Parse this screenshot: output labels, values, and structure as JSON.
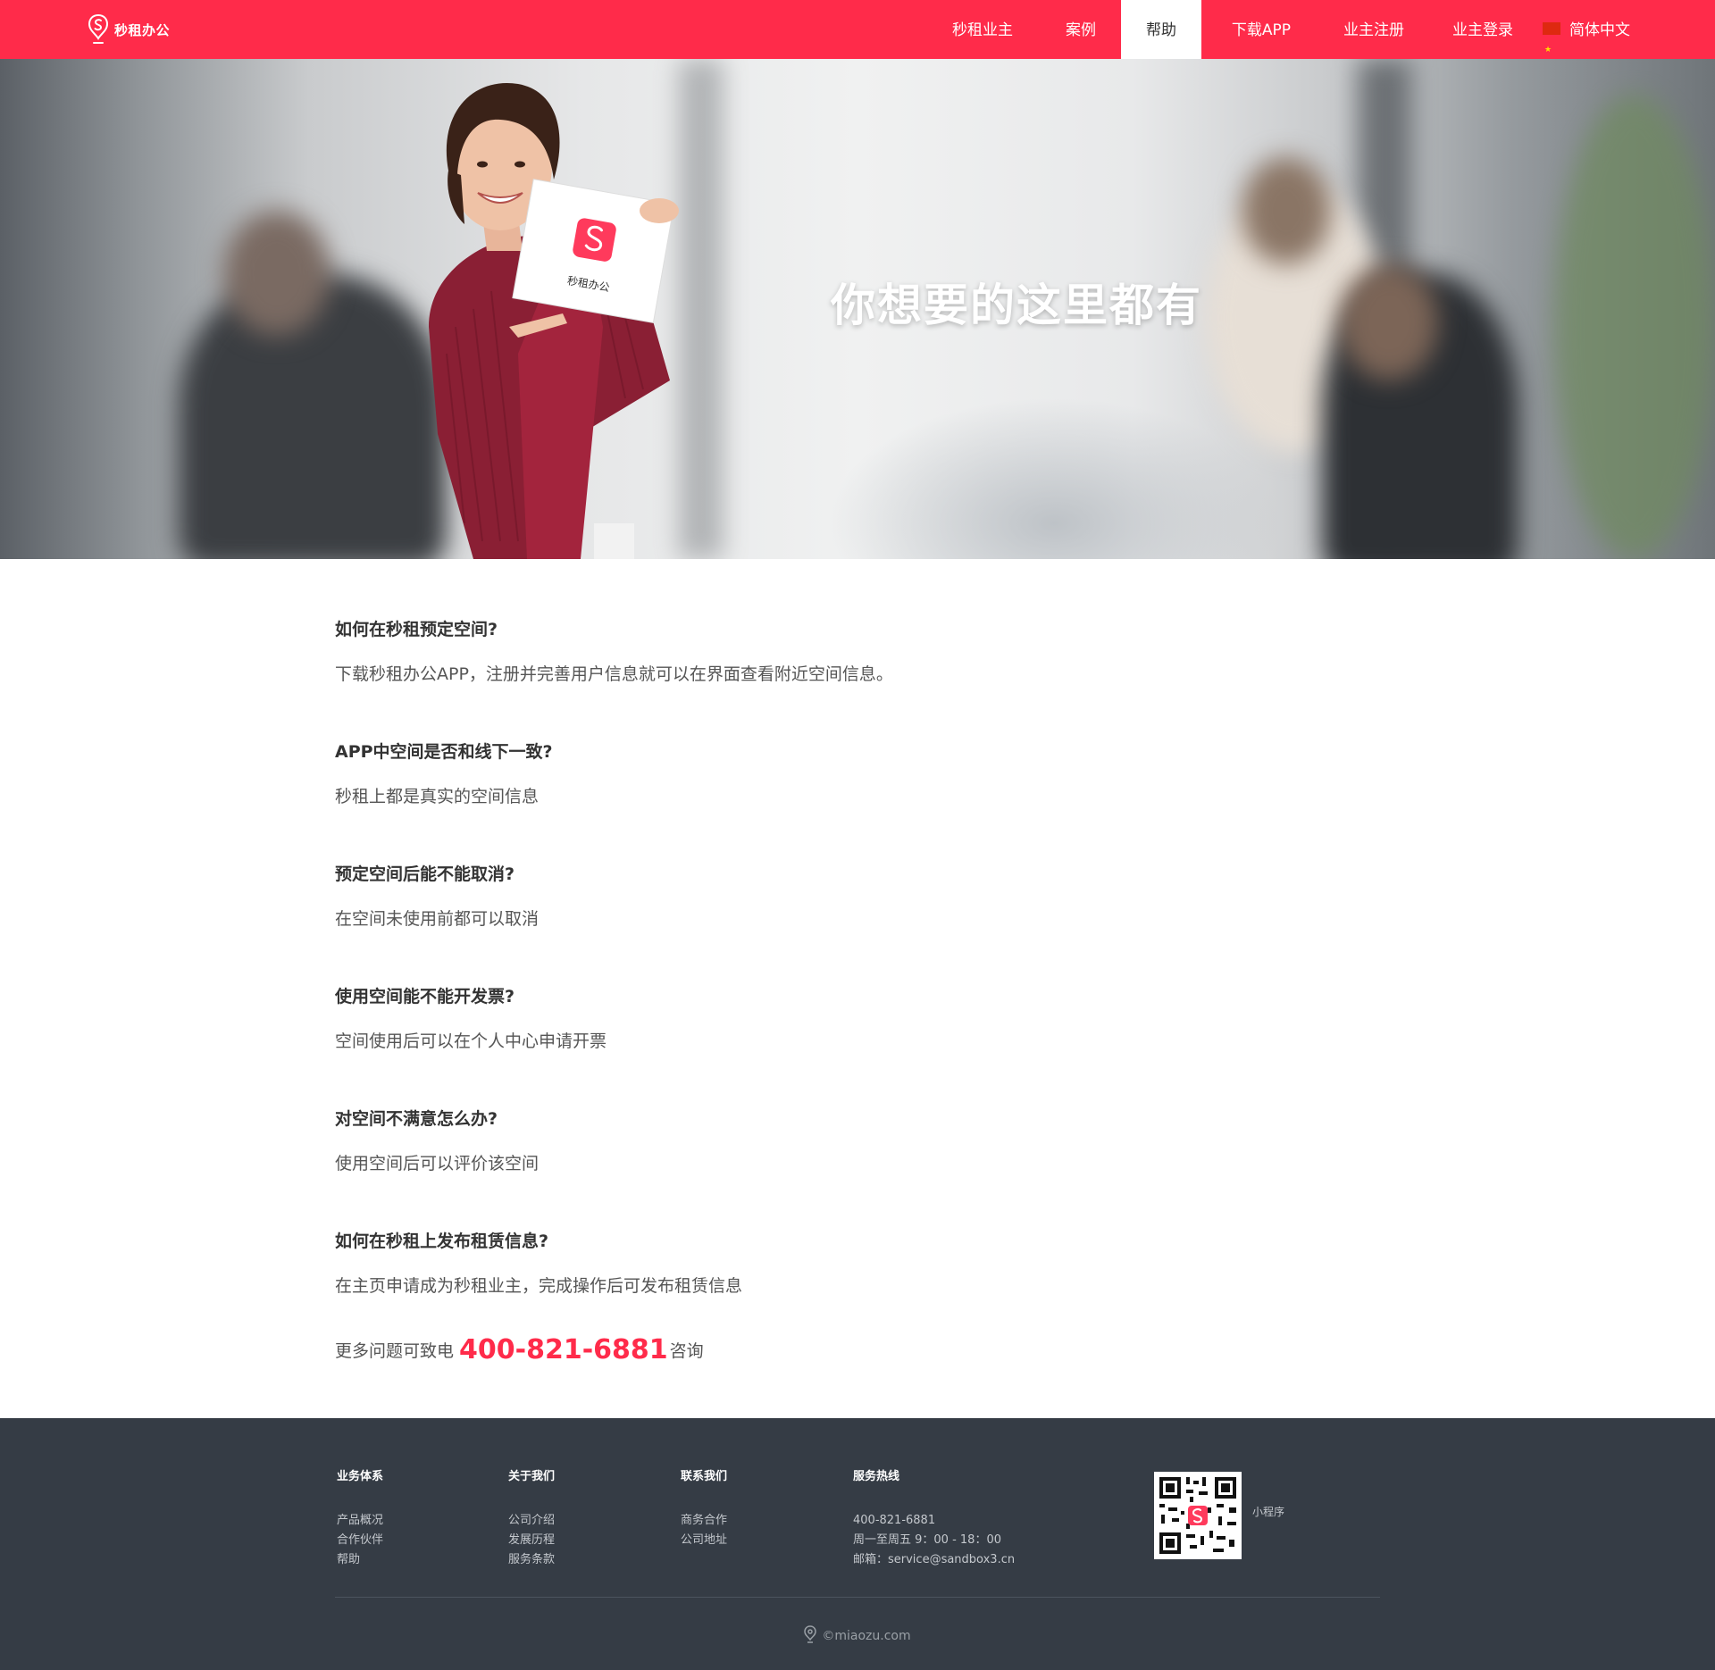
{
  "header": {
    "logo_text": "秒租办公",
    "nav": [
      {
        "label": "秒租业主",
        "active": false
      },
      {
        "label": "案例",
        "active": false
      },
      {
        "label": "帮助",
        "active": true
      },
      {
        "label": "下载APP",
        "active": false
      },
      {
        "label": "业主注册",
        "active": false
      },
      {
        "label": "业主登录",
        "active": false
      },
      {
        "label": "简体中文",
        "active": false,
        "icon": "china-flag-icon"
      }
    ]
  },
  "banner": {
    "title": "你想要的这里都有",
    "card_text": "秒租办公"
  },
  "faq": [
    {
      "q": "如何在秒租预定空间?",
      "a": "下载秒租办公APP，注册并完善用户信息就可以在界面查看附近空间信息。"
    },
    {
      "q": "APP中空间是否和线下一致?",
      "a": "秒租上都是真实的空间信息"
    },
    {
      "q": "预定空间后能不能取消?",
      "a": "在空间未使用前都可以取消"
    },
    {
      "q": "使用空间能不能开发票?",
      "a": "空间使用后可以在个人中心申请开票"
    },
    {
      "q": "对空间不满意怎么办?",
      "a": "使用空间后可以评价该空间"
    },
    {
      "q": "如何在秒租上发布租赁信息?",
      "a": "在主页申请成为秒租业主，完成操作后可发布租赁信息"
    }
  ],
  "contact": {
    "prefix": "更多问题可致电",
    "phone": "400-821-6881",
    "suffix": "咨询"
  },
  "footer": {
    "columns": [
      {
        "title": "业务体系",
        "links": [
          "产品概况",
          "合作伙伴",
          "帮助"
        ]
      },
      {
        "title": "关于我们",
        "links": [
          "公司介绍",
          "发展历程",
          "服务条款"
        ]
      },
      {
        "title": "联系我们",
        "links": [
          "商务合作",
          "公司地址"
        ]
      },
      {
        "title": "服务热线",
        "links": [
          "400-821-6881",
          "周一至周五 9：00 - 18：00",
          "邮箱：service@sandbox3.cn"
        ]
      }
    ],
    "qr_label": "小程序",
    "copyright": "©miaozu.com"
  },
  "colors": {
    "brand": "#ff2b4a",
    "footer_bg": "#353c45"
  }
}
